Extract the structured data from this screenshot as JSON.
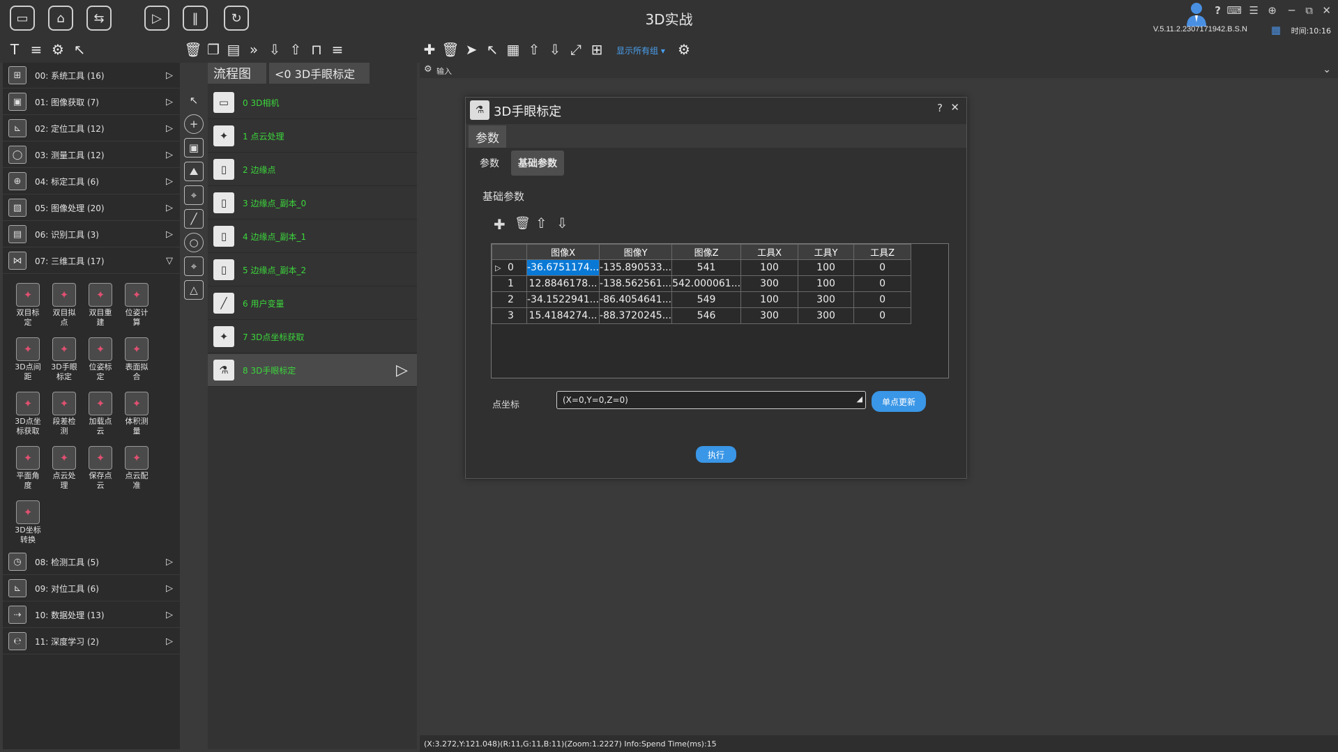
{
  "app": {
    "title": "3D实战",
    "version": "V.5.11.2.2307171942.B.S.N",
    "clock": "时间:10:16",
    "help": "?",
    "min": "─",
    "restore": "⧉",
    "close": "✕"
  },
  "top_buttons": [
    "open-folder",
    "home",
    "usb",
    "play",
    "pause",
    "refresh"
  ],
  "right_toolbar": {
    "group_label": "显示所有组"
  },
  "right_header": {
    "label": "输入"
  },
  "categories": [
    {
      "label": "00: 系统工具 (16)",
      "arrow": "▷"
    },
    {
      "label": "01: 图像获取 (7)",
      "arrow": "▷"
    },
    {
      "label": "02: 定位工具 (12)",
      "arrow": "▷"
    },
    {
      "label": "03: 测量工具 (12)",
      "arrow": "▷"
    },
    {
      "label": "04: 标定工具 (6)",
      "arrow": "▷"
    },
    {
      "label": "05: 图像处理 (20)",
      "arrow": "▷"
    },
    {
      "label": "06: 识别工具 (3)",
      "arrow": "▷"
    },
    {
      "label": "07: 三维工具 (17)",
      "arrow": "▽"
    }
  ],
  "categories_bottom": [
    {
      "label": "08: 检测工具 (5)",
      "arrow": "▷"
    },
    {
      "label": "09: 对位工具 (6)",
      "arrow": "▷"
    },
    {
      "label": "10: 数据处理 (13)",
      "arrow": "▷"
    },
    {
      "label": "11: 深度学习 (2)",
      "arrow": "▷"
    }
  ],
  "tools": [
    {
      "l1": "双目标",
      "l2": "定",
      "l3": ""
    },
    {
      "l1": "双目拟",
      "l2": "点",
      "l3": ""
    },
    {
      "l1": "双目重",
      "l2": "建",
      "l3": ""
    },
    {
      "l1": "位姿计",
      "l2": "算",
      "l3": ""
    },
    {
      "l1": "3D点间",
      "l2": "距",
      "l3": ""
    },
    {
      "l1": "3D手眼",
      "l2": "标定",
      "l3": ""
    },
    {
      "l1": "位姿标",
      "l2": "定",
      "l3": ""
    },
    {
      "l1": "表面拟",
      "l2": "合",
      "l3": ""
    },
    {
      "l1": "3D点坐",
      "l2": "标获取",
      "l3": ""
    },
    {
      "l1": "段差检",
      "l2": "测",
      "l3": ""
    },
    {
      "l1": "加载点",
      "l2": "云",
      "l3": ""
    },
    {
      "l1": "体积测",
      "l2": "量",
      "l3": ""
    },
    {
      "l1": "平面角",
      "l2": "度",
      "l3": ""
    },
    {
      "l1": "点云处",
      "l2": "理",
      "l3": ""
    },
    {
      "l1": "保存点",
      "l2": "云",
      "l3": ""
    },
    {
      "l1": "点云配",
      "l2": "准",
      "l3": ""
    },
    {
      "l1": "3D坐标",
      "l2": "转换",
      "l3": ""
    }
  ],
  "flow": {
    "tab1": "流程图",
    "tab2": "<0  3D手眼标定",
    "items": [
      {
        "label": "0  3D相机"
      },
      {
        "label": "1  点云处理"
      },
      {
        "label": "2  边缘点"
      },
      {
        "label": "3  边缘点_副本_0"
      },
      {
        "label": "4  边缘点_副本_1"
      },
      {
        "label": "5  边缘点_副本_2"
      },
      {
        "label": "6  用户变量"
      },
      {
        "label": "7  3D点坐标获取"
      },
      {
        "label": "8 3D手眼标定"
      }
    ],
    "active_arrow": "▷"
  },
  "dialog": {
    "title": "3D手眼标定",
    "help": "?",
    "close": "✕",
    "group_tab": "参数",
    "tab_params": "参数",
    "tab_basic": "基础参数",
    "section": "基础参数",
    "table": {
      "headers": [
        "",
        "图像X",
        "图像Y",
        "图像Z",
        "工具X",
        "工具Y",
        "工具Z"
      ],
      "rows": [
        {
          "marker": "▷",
          "idx": "0",
          "cells": [
            "-36.6751174...",
            "-135.890533...",
            "541",
            "100",
            "100",
            "0"
          ]
        },
        {
          "marker": "",
          "idx": "1",
          "cells": [
            "12.8846178...",
            "-138.562561...",
            "542.000061...",
            "300",
            "100",
            "0"
          ]
        },
        {
          "marker": "",
          "idx": "2",
          "cells": [
            "-34.1522941...",
            "-86.4054641...",
            "549",
            "100",
            "300",
            "0"
          ]
        },
        {
          "marker": "",
          "idx": "3",
          "cells": [
            "15.4184274...",
            "-88.3720245...",
            "546",
            "300",
            "300",
            "0"
          ]
        }
      ]
    },
    "point_label": "点坐标",
    "point_value": "(X=0,Y=0,Z=0)",
    "update_btn": "单点更新",
    "exec_btn": "执行"
  },
  "status": "(X:3.272,Y:121.048)(R:11,G:11,B:11)(Zoom:1.2227)  Info:Spend Time(ms):15",
  "colors": {
    "flow_text": "#3cd73c",
    "accent": "#3a96e6",
    "selection": "#0a79d6"
  }
}
